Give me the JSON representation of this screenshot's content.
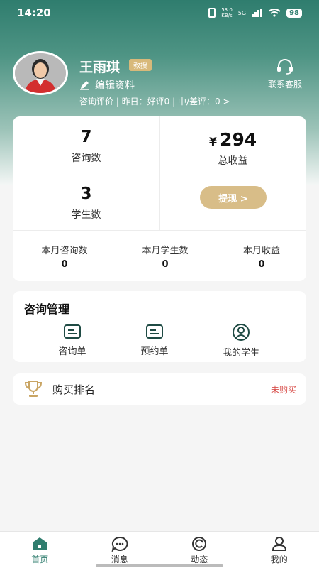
{
  "status_bar": {
    "time": "14:20",
    "network_speed": "53.0",
    "network_speed_unit": "KB/s",
    "network_type": "5G",
    "battery": "98"
  },
  "profile": {
    "name": "王雨琪",
    "title_badge": "教授",
    "edit_label": "编辑资料",
    "review_summary": "咨询评价 | 昨日：好评0 | 中/差评：0 >",
    "service_label": "联系客服"
  },
  "stats": {
    "consult_count": "7",
    "consult_label": "咨询数",
    "student_count": "3",
    "student_label": "学生数",
    "income_symbol": "¥",
    "income_value": "294",
    "income_label": "总收益",
    "withdraw_label": "提现 >"
  },
  "monthly": [
    {
      "label": "本月咨询数",
      "value": "0"
    },
    {
      "label": "本月学生数",
      "value": "0"
    },
    {
      "label": "本月收益",
      "value": "0"
    }
  ],
  "manage": {
    "title": "咨询管理",
    "items": [
      {
        "label": "咨询单",
        "icon": "document-icon"
      },
      {
        "label": "预约单",
        "icon": "document-icon"
      },
      {
        "label": "我的学生",
        "icon": "user-circle-icon"
      }
    ]
  },
  "ranking": {
    "label": "购买排名",
    "status": "未购买",
    "status_color": "#d9534f"
  },
  "nav": {
    "items": [
      {
        "label": "首页",
        "icon": "home-icon",
        "active": true
      },
      {
        "label": "消息",
        "icon": "message-icon",
        "active": false
      },
      {
        "label": "动态",
        "icon": "activity-icon",
        "active": false
      },
      {
        "label": "我的",
        "icon": "person-icon",
        "active": false
      }
    ]
  },
  "colors": {
    "brand": "#2f7d6e",
    "accent_gold": "#d8bd88"
  }
}
